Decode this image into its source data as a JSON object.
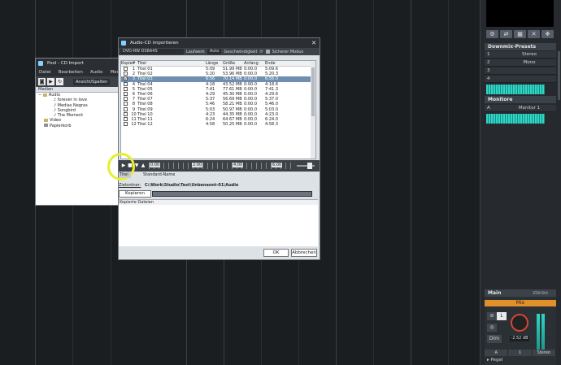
{
  "pool": {
    "title": "Pool - CD Import",
    "menu": [
      "Datei",
      "Bearbeiten",
      "Audio",
      "Medien"
    ],
    "view_select": "Ansicht/Spalten",
    "column_header": "Medien",
    "tree": [
      {
        "label": "Audio",
        "indent": 1,
        "expand": "−"
      },
      {
        "label": "forever in love",
        "indent": 3
      },
      {
        "label": "Medias Negras",
        "indent": 3
      },
      {
        "label": "Songbird",
        "indent": 3
      },
      {
        "label": "The Moment",
        "indent": 3
      },
      {
        "label": "Video",
        "indent": 1
      },
      {
        "label": "Papierkorb",
        "indent": 1
      }
    ]
  },
  "dialog": {
    "title": "Audio-CD importieren",
    "drive": "DVD-RW DS8A4S",
    "drive_label": "Laufwerk",
    "speed": "Auto",
    "speed_label": "Geschwindigkeit",
    "secure_mode": "Sicherer Modus",
    "columns": [
      "Kopie",
      "#",
      "Titel",
      "Länge",
      "Größe",
      "Anfang",
      "Ende"
    ],
    "tracks": [
      {
        "copy": false,
        "num": "1",
        "title": "Titel 01",
        "length": "5:09",
        "size": "51.99 MB",
        "start": "0:00.0",
        "end": "5:09.6"
      },
      {
        "copy": false,
        "num": "2",
        "title": "Titel 02",
        "length": "5:20",
        "size": "53.96 MB",
        "start": "0:00.0",
        "end": "5:20.3"
      },
      {
        "copy": true,
        "num": "3",
        "title": "Titel 03",
        "length": "6:56",
        "size": "70.14 MB",
        "start": "0:00.0",
        "end": "6:56.0",
        "selected": true
      },
      {
        "copy": false,
        "num": "4",
        "title": "Titel 04",
        "length": "4:18",
        "size": "43.52 MB",
        "start": "0:00.0",
        "end": "4:18.6"
      },
      {
        "copy": false,
        "num": "5",
        "title": "Titel 05",
        "length": "7:41",
        "size": "77.61 MB",
        "start": "0:00.0",
        "end": "7:41.3"
      },
      {
        "copy": false,
        "num": "6",
        "title": "Titel 06",
        "length": "4:29",
        "size": "45.30 MB",
        "start": "0:00.0",
        "end": "4:29.6"
      },
      {
        "copy": false,
        "num": "7",
        "title": "Titel 07",
        "length": "5:37",
        "size": "56.69 MB",
        "start": "0:00.0",
        "end": "5:37.0"
      },
      {
        "copy": false,
        "num": "8",
        "title": "Titel 08",
        "length": "5:46",
        "size": "58.21 MB",
        "start": "0:00.0",
        "end": "5:46.0"
      },
      {
        "copy": false,
        "num": "9",
        "title": "Titel 09",
        "length": "5:03",
        "size": "50.97 MB",
        "start": "0:00.0",
        "end": "5:03.0"
      },
      {
        "copy": false,
        "num": "10",
        "title": "Titel 10",
        "length": "4:23",
        "size": "44.35 MB",
        "start": "0:00.0",
        "end": "4:23.0"
      },
      {
        "copy": false,
        "num": "11",
        "title": "Titel 11",
        "length": "6:24",
        "size": "64.67 MB",
        "start": "0:00.0",
        "end": "6:24.0"
      },
      {
        "copy": false,
        "num": "12",
        "title": "Titel 12",
        "length": "4:58",
        "size": "50.25 MB",
        "start": "0:00.0",
        "end": "4:58.3"
      }
    ],
    "timeline": [
      "0:00",
      "2:00",
      "4:00",
      "6:00"
    ],
    "name_field_label": "Titel",
    "name_field_value": "Standard-Name",
    "dest_label": "Zielordner:",
    "dest_path": "C:\\Work\\Studio\\Test\\Unbenannt-01\\Audio",
    "copy_button": "Kopieren",
    "copied_files_header": "Kopierte Dateien",
    "ok": "OK",
    "cancel": "Abbrechen"
  },
  "mixer": {
    "downmix_header": "Downmix-Presets",
    "downmix_rows": [
      {
        "n": "1",
        "v": "Stereo"
      },
      {
        "n": "2",
        "v": "Mono"
      },
      {
        "n": "3",
        "v": ""
      },
      {
        "n": "4",
        "v": ""
      }
    ],
    "monitor_header": "Monitore",
    "monitor_row": {
      "n": "A",
      "v": "Monitor 1"
    },
    "main_header": "Main",
    "main_format": "stereo",
    "mix_label": "Mix",
    "level": "-2.52 dB",
    "dim": "Dim",
    "footer": [
      "A",
      "1",
      "Stereo"
    ],
    "pegel": "Pegel"
  }
}
